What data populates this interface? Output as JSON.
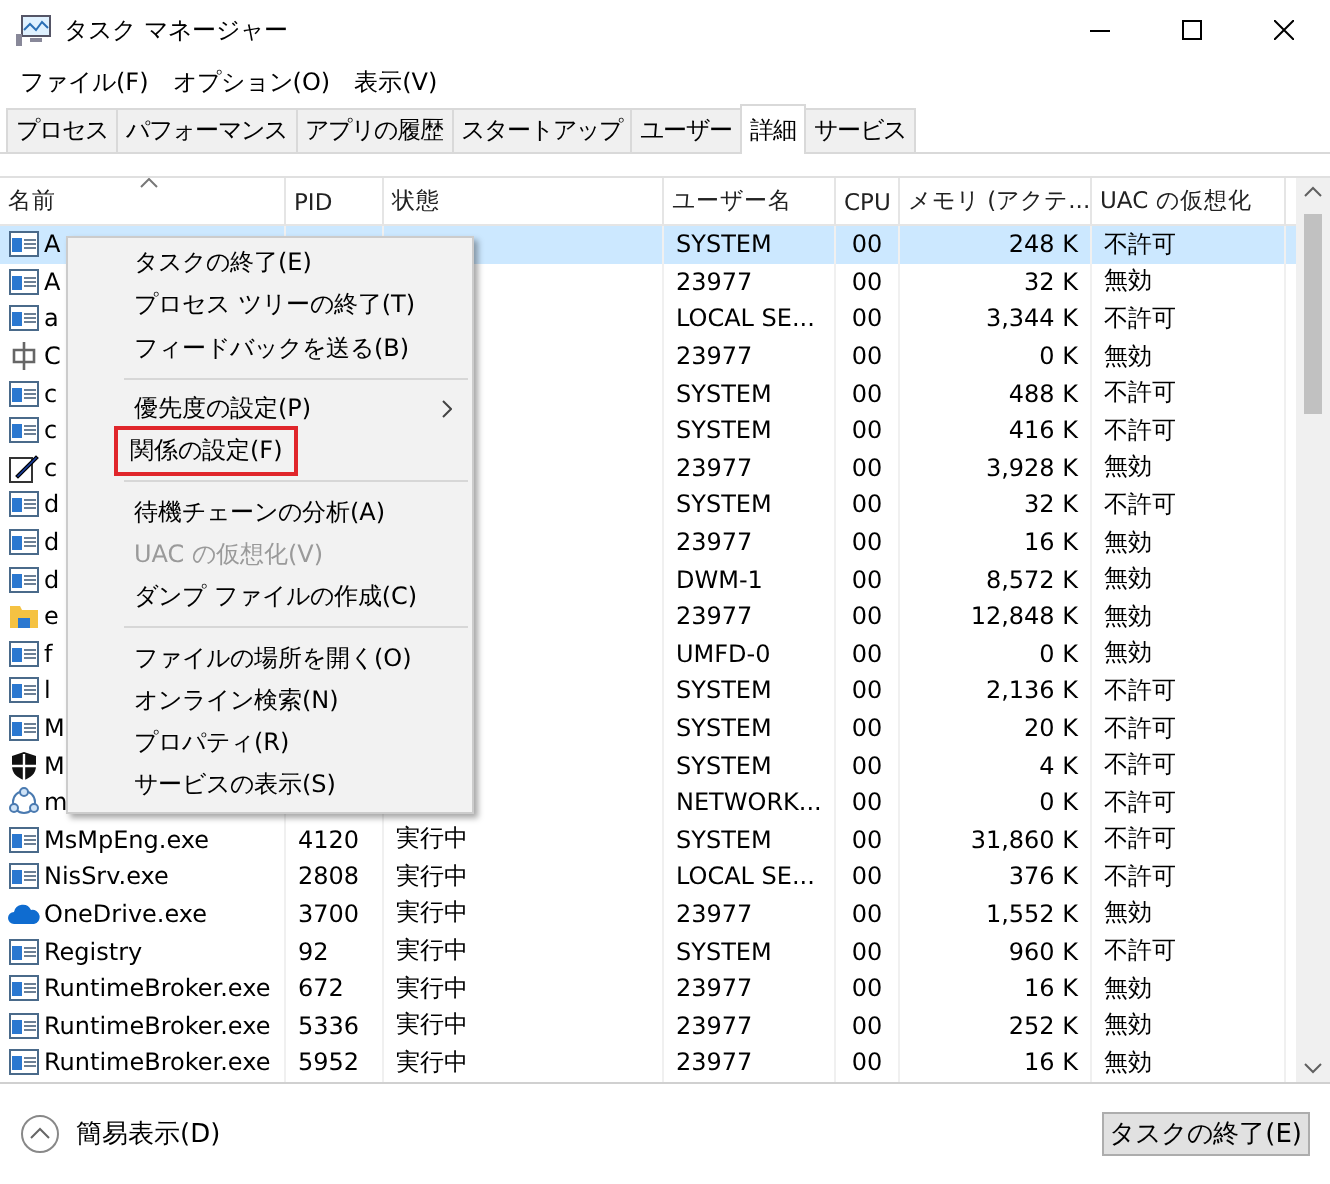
{
  "window": {
    "title": "タスク マネージャー"
  },
  "menu_bar": [
    "ファイル(F)",
    "オプション(O)",
    "表示(V)"
  ],
  "tabs": [
    {
      "label": "プロセス",
      "selected": false
    },
    {
      "label": "パフォーマンス",
      "selected": false
    },
    {
      "label": "アプリの履歴",
      "selected": false
    },
    {
      "label": "スタートアップ",
      "selected": false
    },
    {
      "label": "ユーザー",
      "selected": false
    },
    {
      "label": "詳細",
      "selected": true
    },
    {
      "label": "サービス",
      "selected": false
    }
  ],
  "table": {
    "columns": [
      "名前",
      "PID",
      "状態",
      "ユーザー名",
      "CPU",
      "メモリ (アクテ...",
      "UAC の仮想化"
    ],
    "rows": [
      {
        "kind": "app",
        "name": "A",
        "user": "SYSTEM",
        "cpu": "00",
        "memory": "248 K",
        "uac": "不許可",
        "selected": true
      },
      {
        "kind": "app",
        "name": "A",
        "user": "23977",
        "cpu": "00",
        "memory": "32 K",
        "uac": "無効",
        "selected": false
      },
      {
        "kind": "app",
        "name": "a",
        "user": "LOCAL SE...",
        "cpu": "00",
        "memory": "3,344 K",
        "uac": "不許可",
        "selected": false
      },
      {
        "kind": "service",
        "name": "C",
        "user": "23977",
        "cpu": "00",
        "memory": "0 K",
        "uac": "無効",
        "selected": false
      },
      {
        "kind": "app",
        "name": "c",
        "user": "SYSTEM",
        "cpu": "00",
        "memory": "488 K",
        "uac": "不許可",
        "selected": false
      },
      {
        "kind": "app",
        "name": "c",
        "user": "SYSTEM",
        "cpu": "00",
        "memory": "416 K",
        "uac": "不許可",
        "selected": false
      },
      {
        "kind": "pen",
        "name": "c",
        "user": "23977",
        "cpu": "00",
        "memory": "3,928 K",
        "uac": "無効",
        "selected": false
      },
      {
        "kind": "app",
        "name": "d",
        "user": "SYSTEM",
        "cpu": "00",
        "memory": "32 K",
        "uac": "不許可",
        "selected": false
      },
      {
        "kind": "app",
        "name": "d",
        "user": "23977",
        "cpu": "00",
        "memory": "16 K",
        "uac": "無効",
        "selected": false
      },
      {
        "kind": "app",
        "name": "d",
        "user": "DWM-1",
        "cpu": "00",
        "memory": "8,572 K",
        "uac": "無効",
        "selected": false
      },
      {
        "kind": "folder",
        "name": "e",
        "user": "23977",
        "cpu": "00",
        "memory": "12,848 K",
        "uac": "無効",
        "selected": false
      },
      {
        "kind": "app",
        "name": "f",
        "user": "UMFD-0",
        "cpu": "00",
        "memory": "0 K",
        "uac": "無効",
        "selected": false
      },
      {
        "kind": "app",
        "name": "l",
        "user": "SYSTEM",
        "cpu": "00",
        "memory": "2,136 K",
        "uac": "不許可",
        "selected": false
      },
      {
        "kind": "app",
        "name": "M",
        "user": "SYSTEM",
        "cpu": "00",
        "memory": "20 K",
        "uac": "不許可",
        "selected": false
      },
      {
        "kind": "shield",
        "name": "M",
        "user": "SYSTEM",
        "cpu": "00",
        "memory": "4 K",
        "uac": "不許可",
        "selected": false
      },
      {
        "kind": "network",
        "name": "m",
        "user": "NETWORK...",
        "cpu": "00",
        "memory": "0 K",
        "uac": "不許可",
        "selected": false
      },
      {
        "kind": "app",
        "name": "MsMpEng.exe",
        "pid": "4120",
        "status": "実行中",
        "user": "SYSTEM",
        "cpu": "00",
        "memory": "31,860 K",
        "uac": "不許可",
        "selected": false
      },
      {
        "kind": "app",
        "name": "NisSrv.exe",
        "pid": "2808",
        "status": "実行中",
        "user": "LOCAL SE...",
        "cpu": "00",
        "memory": "376 K",
        "uac": "不許可",
        "selected": false
      },
      {
        "kind": "cloud",
        "name": "OneDrive.exe",
        "pid": "3700",
        "status": "実行中",
        "user": "23977",
        "cpu": "00",
        "memory": "1,552 K",
        "uac": "無効",
        "selected": false
      },
      {
        "kind": "app",
        "name": "Registry",
        "pid": "92",
        "status": "実行中",
        "user": "SYSTEM",
        "cpu": "00",
        "memory": "960 K",
        "uac": "不許可",
        "selected": false
      },
      {
        "kind": "app",
        "name": "RuntimeBroker.exe",
        "pid": "672",
        "status": "実行中",
        "user": "23977",
        "cpu": "00",
        "memory": "16 K",
        "uac": "無効",
        "selected": false
      },
      {
        "kind": "app",
        "name": "RuntimeBroker.exe",
        "pid": "5336",
        "status": "実行中",
        "user": "23977",
        "cpu": "00",
        "memory": "252 K",
        "uac": "無効",
        "selected": false
      },
      {
        "kind": "app",
        "name": "RuntimeBroker.exe",
        "pid": "5952",
        "status": "実行中",
        "user": "23977",
        "cpu": "00",
        "memory": "16 K",
        "uac": "無効",
        "selected": false
      }
    ]
  },
  "context_menu": [
    {
      "kind": "item",
      "label": "タスクの終了(E)",
      "disabled": false,
      "outlined": false
    },
    {
      "kind": "item",
      "label": "プロセス ツリーの終了(T)",
      "disabled": false,
      "outlined": false
    },
    {
      "kind": "item",
      "label": "フィードバックを送る(B)",
      "disabled": false,
      "outlined": false
    },
    {
      "kind": "separator"
    },
    {
      "kind": "submenu",
      "label": "優先度の設定(P)",
      "disabled": false,
      "outlined": false
    },
    {
      "kind": "item",
      "label": "関係の設定(F)",
      "disabled": false,
      "outlined": true
    },
    {
      "kind": "separator"
    },
    {
      "kind": "item",
      "label": "待機チェーンの分析(A)",
      "disabled": false,
      "outlined": false
    },
    {
      "kind": "item",
      "label": "UAC の仮想化(V)",
      "disabled": true,
      "outlined": false
    },
    {
      "kind": "item",
      "label": "ダンプ ファイルの作成(C)",
      "disabled": false,
      "outlined": false
    },
    {
      "kind": "separator"
    },
    {
      "kind": "item",
      "label": "ファイルの場所を開く(O)",
      "disabled": false,
      "outlined": false
    },
    {
      "kind": "item",
      "label": "オンライン検索(N)",
      "disabled": false,
      "outlined": false
    },
    {
      "kind": "item",
      "label": "プロパティ(R)",
      "disabled": false,
      "outlined": false
    },
    {
      "kind": "item",
      "label": "サービスの表示(S)",
      "disabled": false,
      "outlined": false
    }
  ],
  "footer": {
    "toggle": "簡易表示(D)",
    "button": "タスクの終了(E)"
  }
}
